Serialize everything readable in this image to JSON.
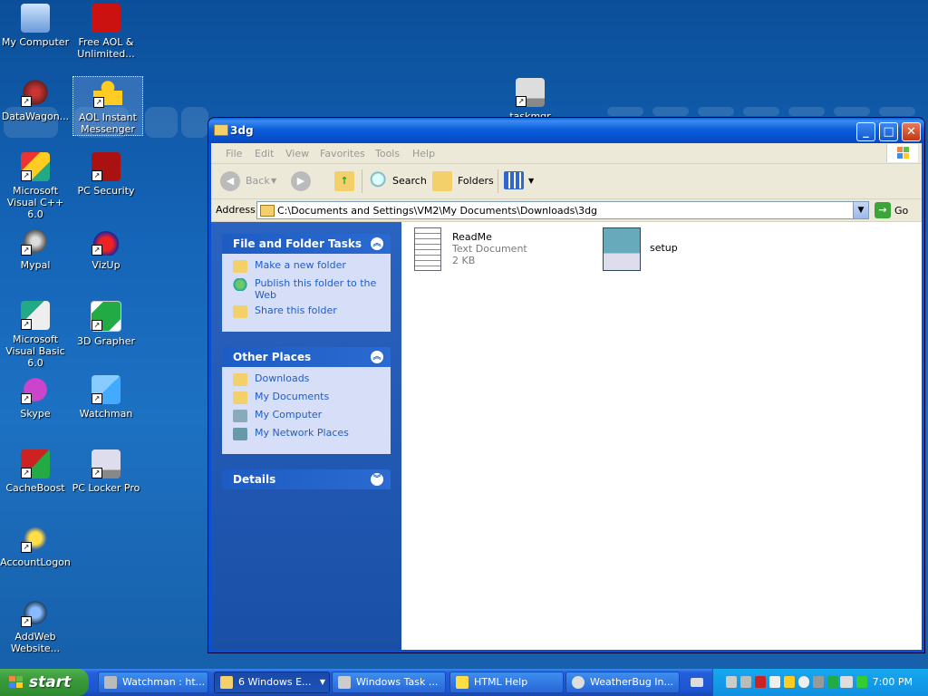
{
  "desktop": {
    "icons": [
      {
        "label": "My Computer"
      },
      {
        "label": "Free AOL & Unlimited..."
      },
      {
        "label": "DataWagon..."
      },
      {
        "label": "AOL Instant Messenger"
      },
      {
        "label": "Microsoft Visual C++ 6.0"
      },
      {
        "label": "PC Security"
      },
      {
        "label": "Mypal"
      },
      {
        "label": "VizUp"
      },
      {
        "label": "Microsoft Visual Basic 6.0"
      },
      {
        "label": "3D Grapher"
      },
      {
        "label": "Skype"
      },
      {
        "label": "Watchman"
      },
      {
        "label": "CacheBoost"
      },
      {
        "label": "PC Locker Pro"
      },
      {
        "label": "AccountLogon"
      },
      {
        "label": "AddWeb Website..."
      },
      {
        "label": "taskmgr"
      }
    ]
  },
  "window": {
    "title": "3dg",
    "menu": [
      "File",
      "Edit",
      "View",
      "Favorites",
      "Tools",
      "Help"
    ],
    "toolbar": {
      "back": "Back",
      "search": "Search",
      "folders": "Folders"
    },
    "address": {
      "label": "Address",
      "value": "C:\\Documents and Settings\\VM2\\My Documents\\Downloads\\3dg",
      "go": "Go"
    },
    "panels": {
      "file_tasks": {
        "title": "File and Folder Tasks",
        "items": [
          "Make a new folder",
          "Publish this folder to the Web",
          "Share this folder"
        ]
      },
      "other_places": {
        "title": "Other Places",
        "items": [
          "Downloads",
          "My Documents",
          "My Computer",
          "My Network Places"
        ]
      },
      "details": {
        "title": "Details"
      }
    },
    "files": [
      {
        "name": "ReadMe",
        "type": "Text Document",
        "size": "2 KB"
      },
      {
        "name": "setup"
      }
    ]
  },
  "taskbar": {
    "start": "start",
    "buttons": [
      {
        "label": "Watchman : ht..."
      },
      {
        "label": "6 Windows E..."
      },
      {
        "label": "Windows Task ..."
      },
      {
        "label": "HTML Help"
      },
      {
        "label": "WeatherBug In..."
      }
    ],
    "clock": "7:00 PM"
  }
}
